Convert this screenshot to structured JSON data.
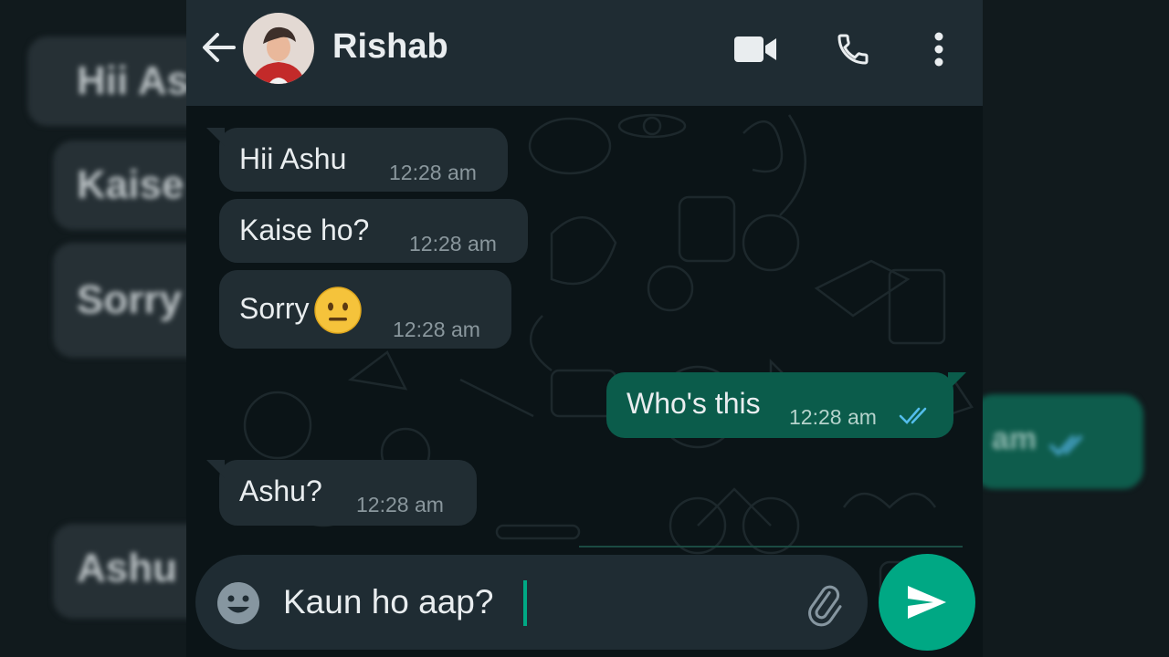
{
  "chat": {
    "contact_name": "Rishab",
    "messages": [
      {
        "text": "Hii Ashu",
        "time": "12:28 am",
        "direction": "incoming"
      },
      {
        "text": "Kaise ho?",
        "time": "12:28 am",
        "direction": "incoming"
      },
      {
        "text": "Sorry",
        "emoji": "neutral-face",
        "time": "12:28 am",
        "direction": "incoming"
      },
      {
        "text": "Who's this",
        "time": "12:28 am",
        "direction": "outgoing",
        "status": "read"
      },
      {
        "text": "Ashu?",
        "time": "12:28 am",
        "direction": "incoming"
      }
    ]
  },
  "composer": {
    "value": "Kaun ho aap?"
  },
  "backdrop": {
    "left": [
      "Hii As",
      "Kaise",
      "Sorry",
      "Ashu"
    ],
    "right_time": "am"
  },
  "icons": {
    "back": "arrow-left-icon",
    "video": "video-call-icon",
    "call": "phone-icon",
    "menu": "more-vertical-icon",
    "emoji": "emoji-icon",
    "attach": "paperclip-icon",
    "send": "send-icon",
    "read": "double-check-icon"
  },
  "colors": {
    "header": "#1f2c33",
    "incoming_bubble": "#212d33",
    "outgoing_bubble": "#0b5c4b",
    "accent": "#00a884",
    "read_ticks": "#53bdeb"
  }
}
